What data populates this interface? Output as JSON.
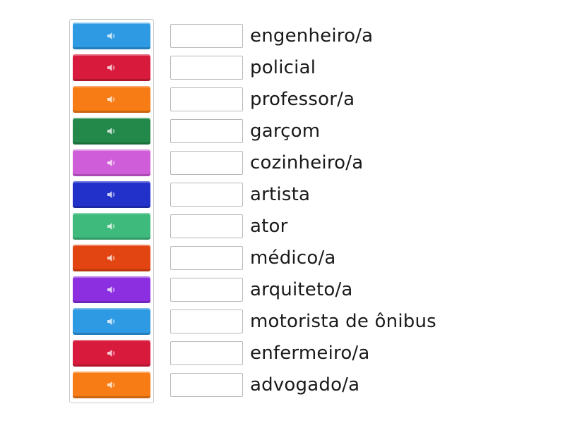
{
  "tiles": [
    {
      "icon": "speaker-icon",
      "color": "#2e9ae3"
    },
    {
      "icon": "speaker-icon",
      "color": "#d81b3c"
    },
    {
      "icon": "speaker-icon",
      "color": "#f77c16"
    },
    {
      "icon": "speaker-icon",
      "color": "#22894a"
    },
    {
      "icon": "speaker-icon",
      "color": "#cf5cd8"
    },
    {
      "icon": "speaker-icon",
      "color": "#2131c9"
    },
    {
      "icon": "speaker-icon",
      "color": "#3dba7c"
    },
    {
      "icon": "speaker-icon",
      "color": "#e24512"
    },
    {
      "icon": "speaker-icon",
      "color": "#8c2fe0"
    },
    {
      "icon": "speaker-icon",
      "color": "#2e9ae3"
    },
    {
      "icon": "speaker-icon",
      "color": "#d81b3c"
    },
    {
      "icon": "speaker-icon",
      "color": "#f77c16"
    }
  ],
  "rows": [
    {
      "word": "engenheiro/a"
    },
    {
      "word": "policial"
    },
    {
      "word": "professor/a"
    },
    {
      "word": "garçom"
    },
    {
      "word": "cozinheiro/a"
    },
    {
      "word": "artista"
    },
    {
      "word": "ator"
    },
    {
      "word": "médico/a"
    },
    {
      "word": "arquiteto/a"
    },
    {
      "word": "motorista de ônibus"
    },
    {
      "word": "enfermeiro/a"
    },
    {
      "word": "advogado/a"
    }
  ]
}
